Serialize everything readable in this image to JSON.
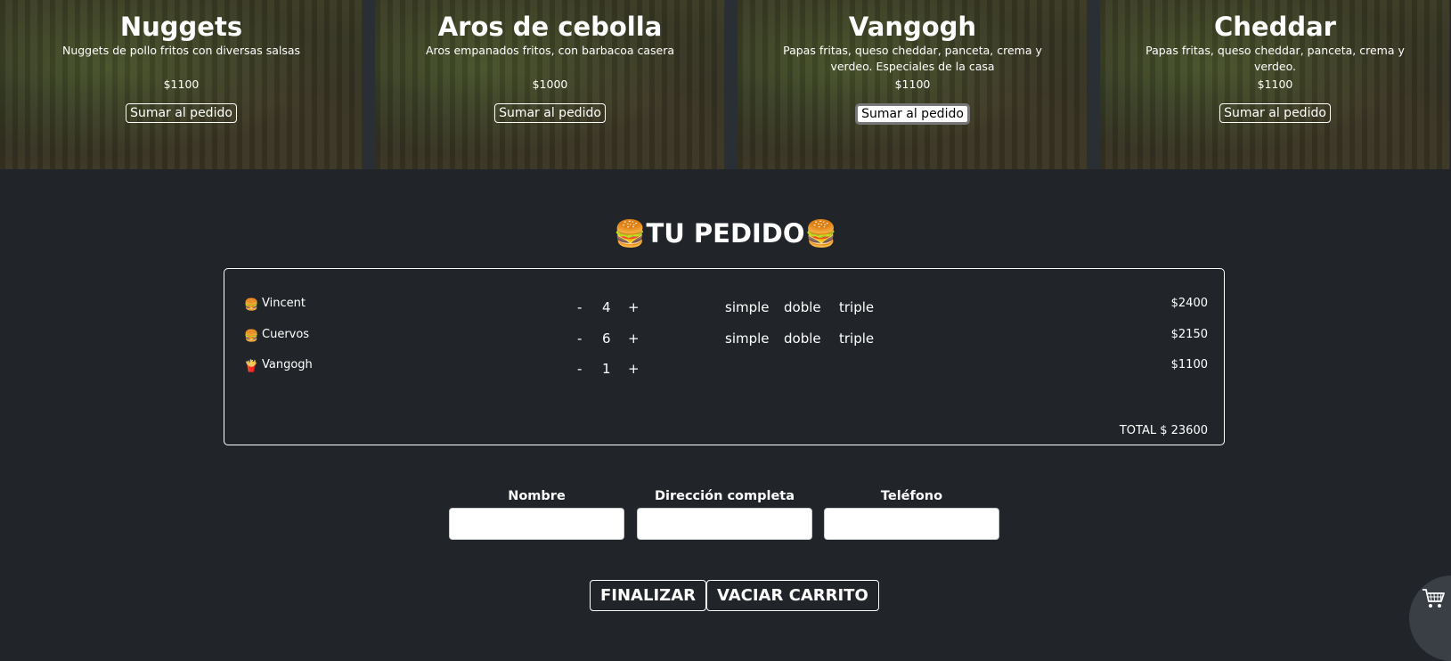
{
  "products": [
    {
      "title": "Nuggets",
      "description": "Nuggets de pollo fritos con diversas salsas",
      "price": "$1100",
      "button": "Sumar al pedido"
    },
    {
      "title": "Aros de cebolla",
      "description": "Aros empanados fritos, con barbacoa casera",
      "price": "$1000",
      "button": "Sumar al pedido"
    },
    {
      "title": "Vangogh",
      "description": "Papas fritas, queso cheddar, panceta, crema y verdeo. Especiales de la casa",
      "price": "$1100",
      "button": "Sumar al pedido"
    },
    {
      "title": "Cheddar",
      "description": "Papas fritas, queso cheddar, panceta, crema y verdeo.",
      "price": "$1100",
      "button": "Sumar al pedido"
    }
  ],
  "order": {
    "title_emoji": "🍔",
    "title": "TU PEDIDO",
    "items": [
      {
        "emoji": "🍔",
        "name": "Vincent",
        "minus": "-",
        "qty": "4",
        "plus": "+",
        "options": [
          "simple",
          "doble",
          "triple"
        ],
        "price": "$2400"
      },
      {
        "emoji": "🍔",
        "name": "Cuervos",
        "minus": "-",
        "qty": "6",
        "plus": "+",
        "options": [
          "simple",
          "doble",
          "triple"
        ],
        "price": "$2150"
      },
      {
        "emoji": "🍟",
        "name": "Vangogh",
        "minus": "-",
        "qty": "1",
        "plus": "+",
        "price": "$1100"
      }
    ],
    "total": "TOTAL $ 23600"
  },
  "form": {
    "name_label": "Nombre",
    "address_label": "Dirección completa",
    "phone_label": "Teléfono"
  },
  "actions": {
    "finish": "FINALIZAR",
    "clear": "VACIAR CARRITO"
  }
}
